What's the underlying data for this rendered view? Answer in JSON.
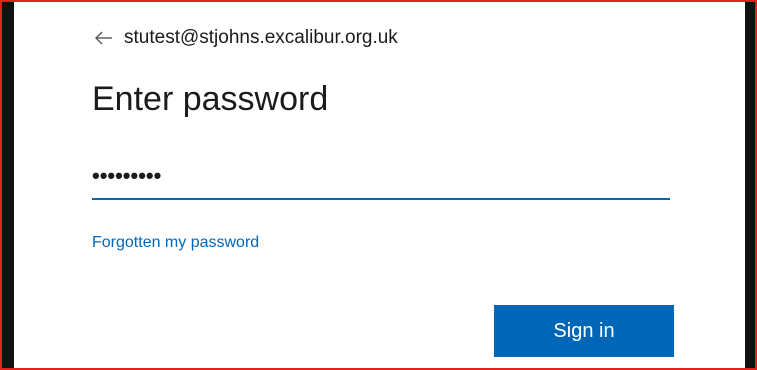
{
  "identity": {
    "back_icon": "back-arrow-icon",
    "email": "stutest@stjohns.excalibur.org.uk"
  },
  "title": "Enter password",
  "password": {
    "masked_value": "•••••••••"
  },
  "forgot_link": "Forgotten my password",
  "signin_button": "Sign in",
  "colors": {
    "accent": "#0067b8",
    "text": "#1b1b1b",
    "frame_border": "#e3211c"
  }
}
